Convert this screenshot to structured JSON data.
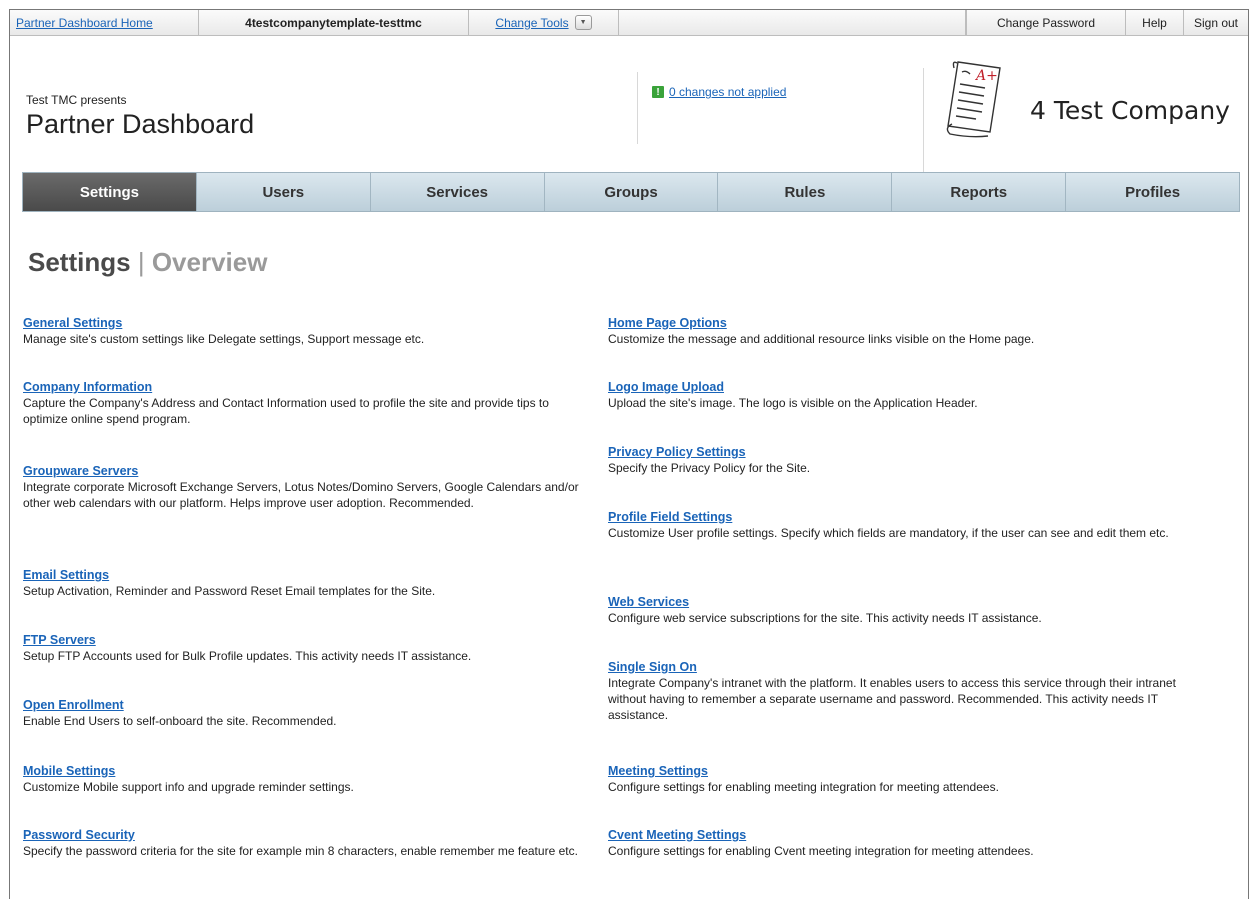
{
  "topbar": {
    "home": "Partner Dashboard Home",
    "company": "4testcompanytemplate-testtmc",
    "change_tools": "Change Tools",
    "change_password": "Change Password",
    "help": "Help",
    "sign_out": "Sign out"
  },
  "header": {
    "presents": "Test TMC presents",
    "title": "Partner Dashboard",
    "changes": "0 changes not applied",
    "changes_icon": "!",
    "logo_text": "4 Test Company",
    "logo_mark": "A+"
  },
  "tabs": [
    {
      "label": "Settings",
      "active": true
    },
    {
      "label": "Users"
    },
    {
      "label": "Services"
    },
    {
      "label": "Groups"
    },
    {
      "label": "Rules"
    },
    {
      "label": "Reports"
    },
    {
      "label": "Profiles"
    }
  ],
  "section": {
    "title": "Settings",
    "separator": "|",
    "subtitle": "Overview"
  },
  "left_items": [
    {
      "title": "General Settings",
      "desc": "Manage site's custom settings like Delegate settings, Support message etc."
    },
    {
      "title": "Company Information",
      "desc": "Capture the Company's Address and Contact Information used to profile the site and provide tips to optimize online spend program."
    },
    {
      "title": "Groupware Servers",
      "desc": "Integrate corporate Microsoft Exchange Servers, Lotus Notes/Domino Servers, Google Calendars and/or other web calendars with our platform. Helps improve user adoption. Recommended."
    },
    {
      "title": "Email Settings",
      "desc": "Setup Activation, Reminder and Password Reset Email templates for the Site."
    },
    {
      "title": "FTP Servers",
      "desc": "Setup FTP Accounts used for Bulk Profile updates. This activity needs IT assistance."
    },
    {
      "title": "Open Enrollment",
      "desc": "Enable End Users to self-onboard the site. Recommended."
    },
    {
      "title": "Mobile Settings",
      "desc": "Customize Mobile support info and upgrade reminder settings."
    },
    {
      "title": "Password Security",
      "desc": "Specify the password criteria for the site for example min 8 characters, enable remember me feature etc."
    }
  ],
  "right_items": [
    {
      "title": "Home Page Options",
      "desc": "Customize the message and additional resource links visible on the Home page."
    },
    {
      "title": "Logo Image Upload",
      "desc": "Upload the site's image. The logo is visible on the Application Header."
    },
    {
      "title": "Privacy Policy Settings",
      "desc": "Specify the Privacy Policy for the Site."
    },
    {
      "title": "Profile Field Settings",
      "desc": "Customize User profile settings. Specify which fields are mandatory, if the user can see and edit them etc."
    },
    {
      "title": "Web Services",
      "desc": "Configure web service subscriptions for the site. This activity needs IT assistance."
    },
    {
      "title": "Single Sign On",
      "desc": "Integrate Company's intranet with the platform. It enables users to access this service through their intranet without having to remember a separate username and password. Recommended. This activity needs IT assistance."
    },
    {
      "title": "Meeting Settings",
      "desc": "Configure settings for enabling meeting integration for meeting attendees."
    },
    {
      "title": "Cvent Meeting Settings",
      "desc": "Configure settings for enabling Cvent meeting integration for meeting attendees."
    }
  ]
}
